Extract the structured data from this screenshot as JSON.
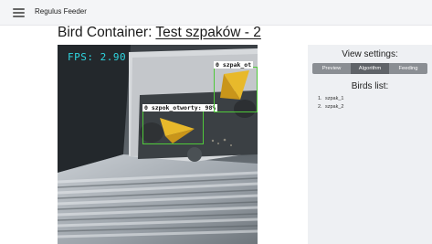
{
  "header": {
    "app_title": "Regulus Feeder"
  },
  "page": {
    "title_prefix": "Bird Container:",
    "container_name": "Test szpaków - 2"
  },
  "video": {
    "fps_text": "FPS: 2.90",
    "detections": [
      {
        "label": "0  szpok_otworty: 98%"
      },
      {
        "label": "0  szpak_ot"
      }
    ]
  },
  "settings": {
    "title": "View settings:",
    "tabs": [
      {
        "label": "Preview"
      },
      {
        "label": "Algorithm"
      },
      {
        "label": "Feeding"
      }
    ],
    "active_tab": "Algorithm",
    "birds_title": "Birds list:",
    "birds": [
      {
        "num": "1.",
        "name": "szpak_1"
      },
      {
        "num": "2.",
        "name": "szpak_2"
      }
    ]
  },
  "colors": {
    "fps": "#2fd6e0",
    "detection_box": "#4fc93a",
    "tab_bg": "#8a8e93",
    "tab_active": "#5f6368",
    "panel_bg": "#eef0f3"
  },
  "icons": {
    "menu": "hamburger-menu-icon"
  }
}
